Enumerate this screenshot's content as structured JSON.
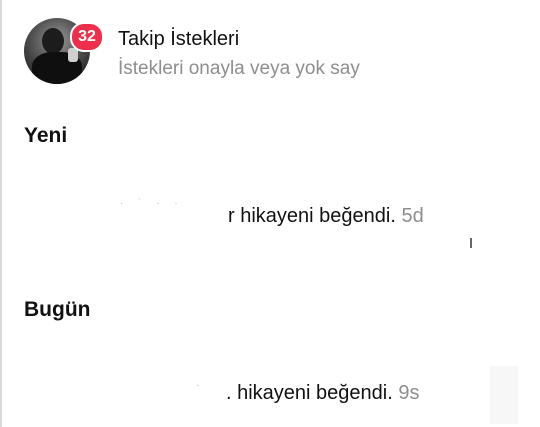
{
  "follow_requests": {
    "title": "Takip İstekleri",
    "subtitle": "İstekleri onayla veya yok say",
    "badge_count": "32",
    "avatar_icon": "user-avatar"
  },
  "sections": [
    {
      "title": "Yeni",
      "notification": {
        "username_tail": "r",
        "action": " hikayeni beğendi.",
        "time": "5d"
      }
    },
    {
      "title": "Bugün",
      "notification": {
        "username_tail": ".",
        "action": " hikayeni beğendi.",
        "time": "9s"
      }
    }
  ],
  "colors": {
    "badge": "#ed2f4c",
    "secondary_text": "#8e8e8e",
    "primary_text": "#111111",
    "background": "#ffffff"
  }
}
